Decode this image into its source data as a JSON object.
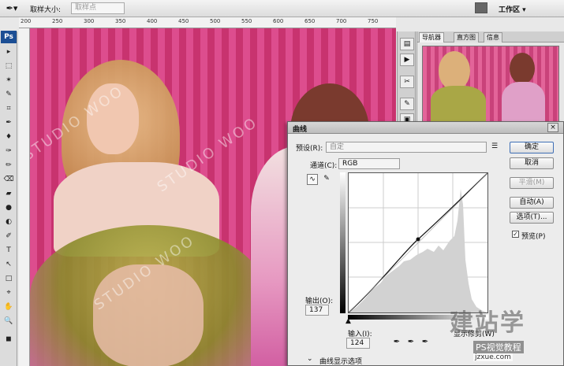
{
  "options_bar": {
    "sample_size_label": "取样大小:",
    "sample_size_value": "取样点",
    "workspace_label": "工作区 ▾"
  },
  "ruler": {
    "ticks": [
      "200",
      "250",
      "300",
      "350",
      "400",
      "450",
      "500",
      "550",
      "600",
      "650",
      "700",
      "750"
    ]
  },
  "toolbar": {
    "logo": "Ps",
    "tools": [
      "▸",
      "⬚",
      "✶",
      "✎",
      "⌗",
      "✒",
      "♦",
      "✑",
      "✏",
      "⌫",
      "▰",
      "●",
      "◐",
      "✐",
      "T",
      "↖",
      "□",
      "⌖",
      "✋",
      "🔍",
      "◼"
    ]
  },
  "navigator": {
    "tabs": [
      "导航器",
      "直方图",
      "信息"
    ]
  },
  "curves_dialog": {
    "title": "曲线",
    "preset_label": "预设(R):",
    "preset_value": "自定",
    "channel_label": "通道(C):",
    "channel_value": "RGB",
    "output_label": "输出(O):",
    "output_value": "137",
    "input_label": "输入(I):",
    "input_value": "124",
    "buttons": {
      "ok": "确定",
      "cancel": "取消",
      "smooth": "平滑(M)",
      "auto": "自动(A)",
      "options": "选项(T)..."
    },
    "preview_label": "预览(P)",
    "preview_checked": true,
    "show_clipping_label": "显示修剪(W)",
    "curve_display_options": "曲线显示选项"
  },
  "watermark": {
    "canvas_text": "STUDIO WOO",
    "brand_big": "建站学",
    "brand_small": "PS视觉教程",
    "url": "jzxue.com"
  }
}
